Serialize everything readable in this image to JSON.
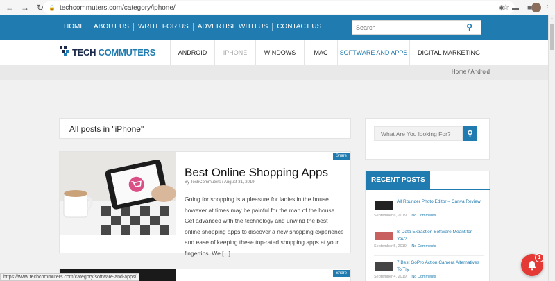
{
  "browser": {
    "url": "techcommuters.com/category/iphone/",
    "back_icon": "arrow-left",
    "forward_icon": "arrow-right",
    "reload_icon": "reload"
  },
  "topnav": {
    "items": [
      "HOME",
      "ABOUT US",
      "WRITE FOR US",
      "ADVERTISE WITH US",
      "CONTACT US"
    ],
    "search_placeholder": "Search"
  },
  "logo": {
    "part1": "TECH",
    "part2": "COMMUTERS"
  },
  "categories": [
    "ANDROID",
    "IPHONE",
    "WINDOWS",
    "MAC",
    "SOFTWARE AND APPS",
    "DIGITAL MARKETING"
  ],
  "breadcrumb": "Home  /  Android",
  "page_heading": "All posts in \"iPhone\"",
  "posts": [
    {
      "share": "Share",
      "title": "Best Online Shopping Apps",
      "meta": "By TechCommuters / August 31, 2019",
      "excerpt": "Going for shopping is a pleasure for ladies in the house however at times may be painful for the man of the house. Get advanced with the technology and unwind the best online shopping apps to discover a new shopping experience and ease of keeping these top-rated shopping apps at your fingertips. We [...]"
    },
    {
      "share": "Share"
    }
  ],
  "sidebar": {
    "search_placeholder": "What Are You looking For?",
    "recent_title": "RECENT POSTS",
    "recent": [
      {
        "title": "All Rounder Photo Editor – Canva Review",
        "date": "September 6, 2019",
        "comments": "No Comments"
      },
      {
        "title": "Is Data Extraction Software Meant for You?",
        "date": "September 5, 2019",
        "comments": "No Comments"
      },
      {
        "title": "7 Best GoPro Action Camera Alternatives To Try",
        "date": "September 4, 2019",
        "comments": "No Comments"
      }
    ]
  },
  "status_url": "https://www.techcommuters.com/category/software-and-apps/",
  "notification": {
    "count": "1"
  },
  "colors": {
    "brand_blue": "#1f7bb0",
    "bell_red": "#e53935"
  }
}
